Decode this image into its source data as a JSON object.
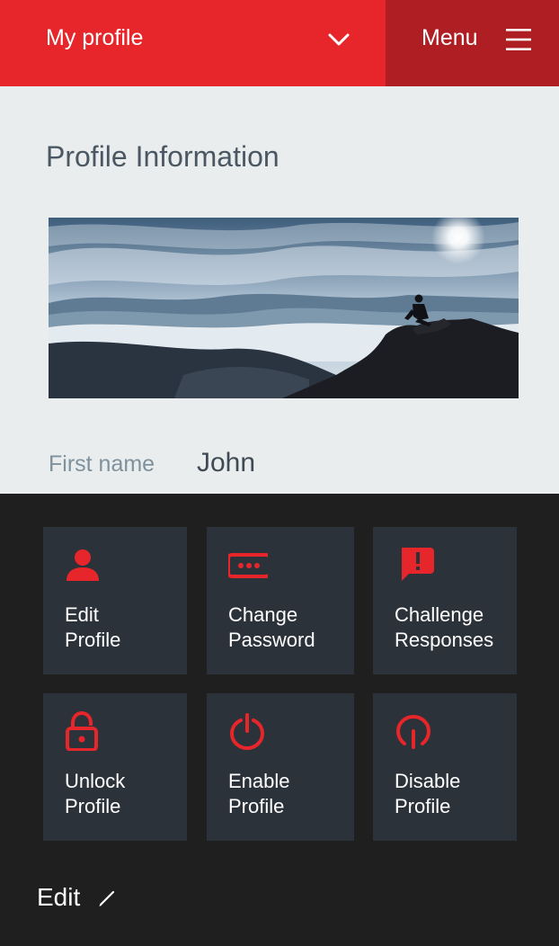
{
  "header": {
    "title": "My profile",
    "menu_label": "Menu"
  },
  "profile": {
    "section_title": "Profile Information",
    "first_name_label": "First name",
    "first_name_value": "John"
  },
  "actions": [
    {
      "label": "Edit\nProfile",
      "icon": "user-icon"
    },
    {
      "label": "Change\nPassword",
      "icon": "password-icon"
    },
    {
      "label": "Challenge\nResponses",
      "icon": "alert-message-icon"
    },
    {
      "label": "Unlock\nProfile",
      "icon": "padlock-icon"
    },
    {
      "label": "Enable\nProfile",
      "icon": "power-icon"
    },
    {
      "label": "Disable\nProfile",
      "icon": "disable-power-icon"
    }
  ],
  "footer": {
    "edit_label": "Edit",
    "edit_icon": "pencil-icon"
  },
  "colors": {
    "accent": "#e6262a",
    "accent_dark": "#ae1e22",
    "tile_bg": "#2c3239",
    "dark_bg": "#1f1f20",
    "light_bg": "#e9edee"
  }
}
